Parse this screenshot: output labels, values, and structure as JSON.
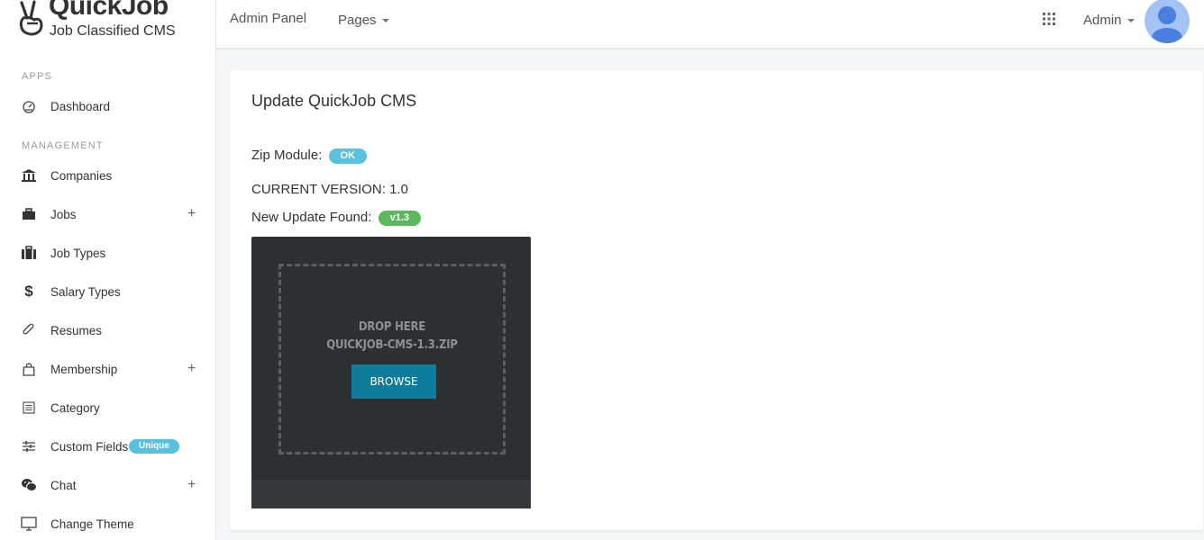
{
  "brand": {
    "title": "QuickJob",
    "subtitle": "Job Classified CMS"
  },
  "sidebar": {
    "sections": [
      {
        "label": "APPS"
      },
      {
        "label": "MANAGEMENT"
      }
    ],
    "items": [
      {
        "label": "Dashboard",
        "icon": "dashboard-icon"
      },
      {
        "label": "Companies",
        "icon": "bank-icon"
      },
      {
        "label": "Jobs",
        "icon": "briefcase-icon",
        "expandable": true,
        "plus": "+"
      },
      {
        "label": "Job Types",
        "icon": "suitcase-icon"
      },
      {
        "label": "Salary Types",
        "icon": "dollar-icon"
      },
      {
        "label": "Resumes",
        "icon": "paperclip-icon"
      },
      {
        "label": "Membership",
        "icon": "shopping-bag-icon",
        "expandable": true,
        "plus": "+"
      },
      {
        "label": "Category",
        "icon": "list-icon"
      },
      {
        "label": "Custom Fields",
        "icon": "sliders-icon",
        "badge": "Unique"
      },
      {
        "label": "Chat",
        "icon": "wechat-icon",
        "expandable": true,
        "plus": "+"
      },
      {
        "label": "Change Theme",
        "icon": "monitor-icon"
      }
    ]
  },
  "topbar": {
    "admin_panel": "Admin Panel",
    "pages": "Pages",
    "user": "Admin",
    "apps_icon": "apps-grid-icon",
    "avatar_icon": "user-avatar-icon"
  },
  "card": {
    "title": "Update QuickJob CMS",
    "zip_label": "Zip Module:",
    "zip_status": "OK",
    "current_version": "CURRENT VERSION: 1.0",
    "update_label": "New Update Found:",
    "update_version": "v1.3"
  },
  "dropzone": {
    "line1": "DROP HERE",
    "line2": "QUICKJOB-CMS-1.3.ZIP",
    "browse": "BROWSE"
  },
  "colors": {
    "info": "#5bc0de",
    "success": "#5cb85c",
    "browse": "#0f7c9a",
    "dropbox_bg": "#2d3033",
    "avatar": "#a4c2f4"
  }
}
